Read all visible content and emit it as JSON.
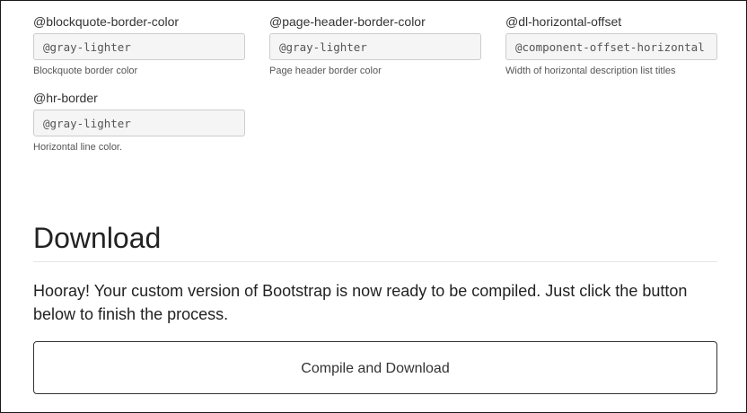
{
  "variables": [
    {
      "label": "@blockquote-border-color",
      "value": "@gray-lighter",
      "help": "Blockquote border color"
    },
    {
      "label": "@page-header-border-color",
      "value": "@gray-lighter",
      "help": "Page header border color"
    },
    {
      "label": "@dl-horizontal-offset",
      "value": "@component-offset-horizontal",
      "help": "Width of horizontal description list titles"
    },
    {
      "label": "@hr-border",
      "value": "@gray-lighter",
      "help": "Horizontal line color."
    }
  ],
  "download": {
    "title": "Download",
    "lead": "Hooray! Your custom version of Bootstrap is now ready to be compiled. Just click the button below to finish the process.",
    "button_label": "Compile and Download"
  }
}
